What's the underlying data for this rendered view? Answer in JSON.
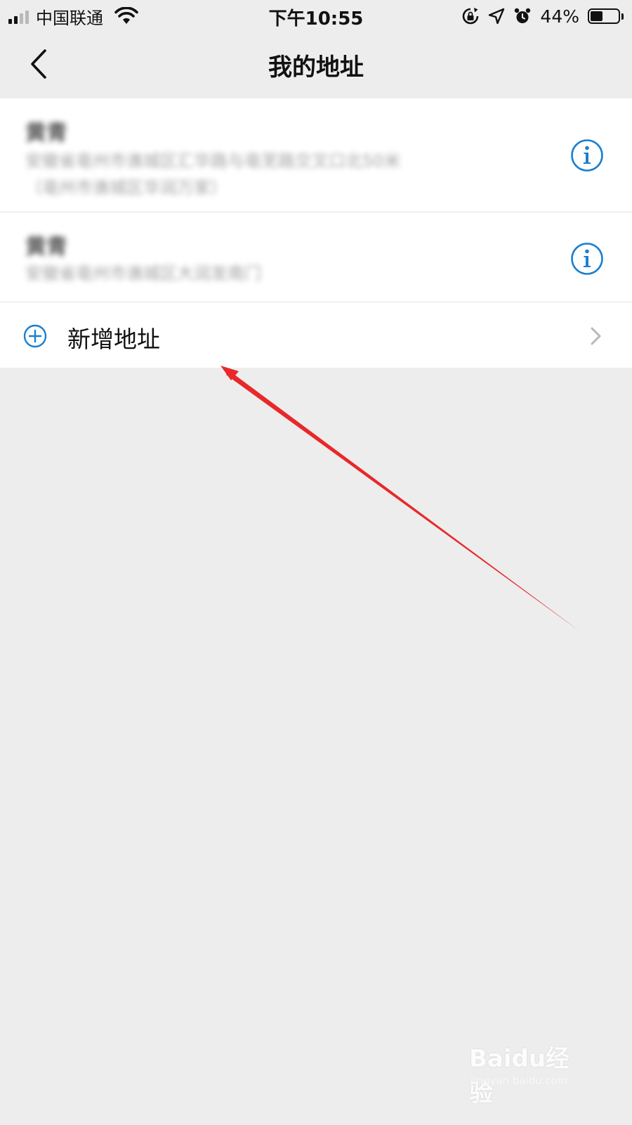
{
  "status_bar": {
    "carrier": "中国联通",
    "time": "下午10:55",
    "battery_percent": "44%",
    "battery_level": 0.44,
    "icons": [
      "signal-icon",
      "wifi-icon",
      "rotation-lock-icon",
      "location-icon",
      "alarm-icon",
      "battery-icon"
    ]
  },
  "nav": {
    "title": "我的地址",
    "back_icon": "chevron-left-icon"
  },
  "addresses": [
    {
      "name": "黄青",
      "detail": "安徽省亳州市谯城区汇华路与亳芜路交叉口北50米",
      "detail_line2": "（亳州市谯城区华润万家）"
    },
    {
      "name": "黄青",
      "detail": "安徽省亳州市谯城区大润发南门"
    }
  ],
  "add_address": {
    "label": "新增地址",
    "icon": "plus-circle-icon"
  },
  "colors": {
    "accent": "#1a7fd0",
    "background": "#ededed",
    "annotation_arrow": "#e8282a"
  },
  "watermark": {
    "logo": "Baidu经验",
    "url": "jingyan.baidu.com"
  }
}
